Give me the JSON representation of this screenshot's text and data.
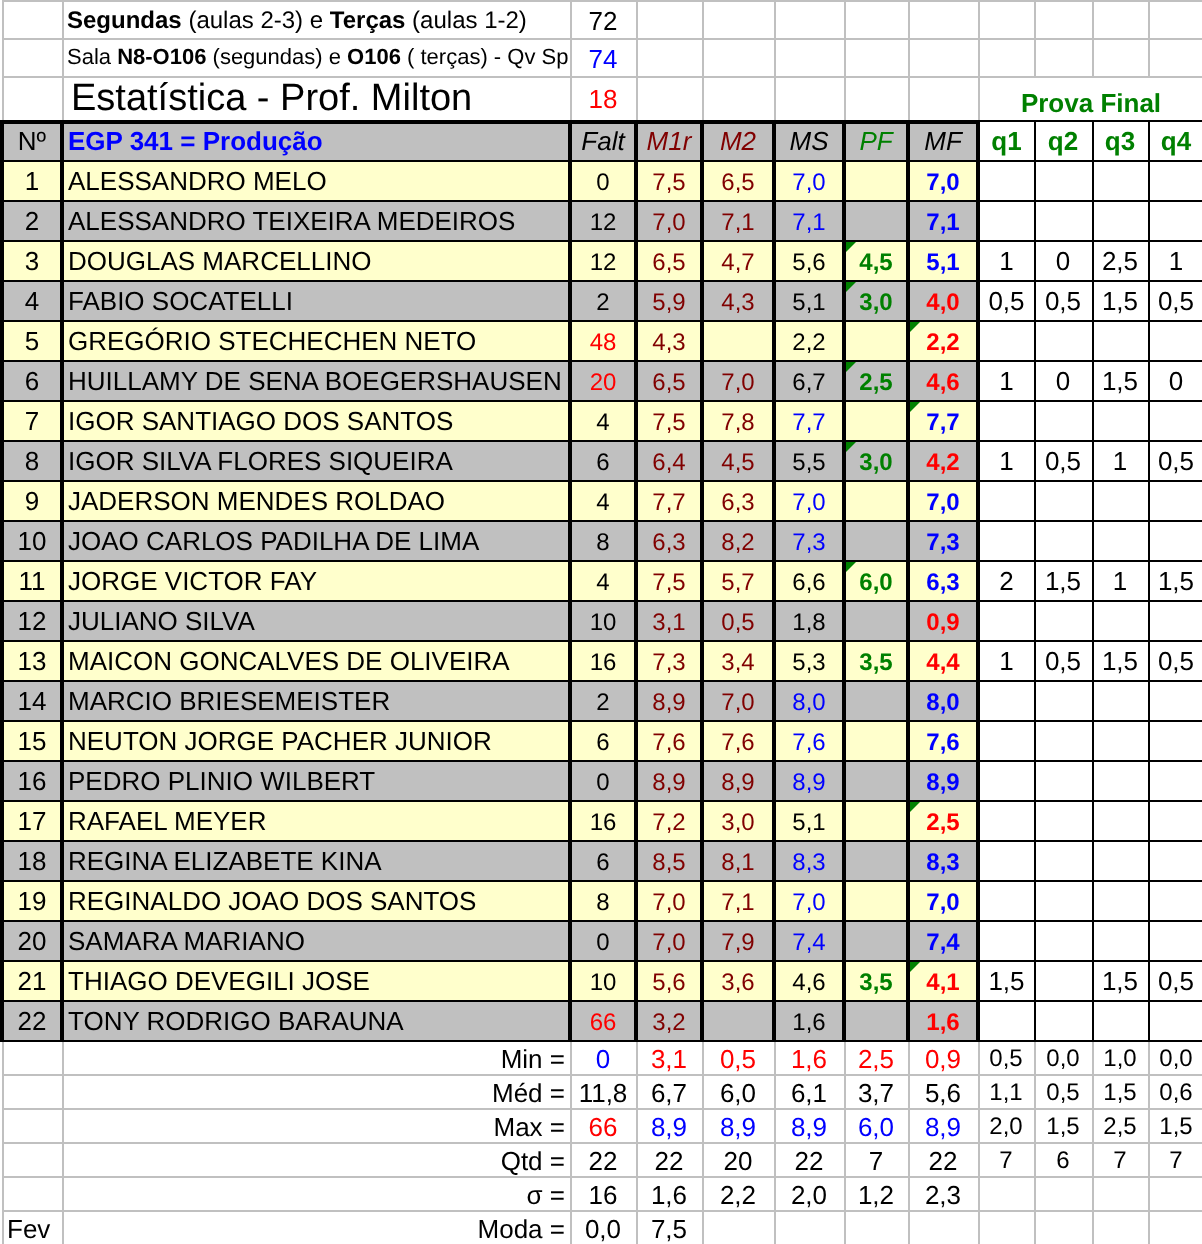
{
  "info": [
    {
      "text": "**Segundas** (aulas 2-3) e **Terças** (aulas 1-2)",
      "value": "72",
      "color": "#000000"
    },
    {
      "text": "Sala **N8-O106** (segundas) e **O106** ( terças) - Qv Sp",
      "value": "74",
      "color": "#0000ff"
    }
  ],
  "title": {
    "text": "Estatística - Prof. Milton",
    "value": "18",
    "color": "#ff0000",
    "group": "Prova Final"
  },
  "columns": [
    "Nº",
    "EGP 341 = Produção",
    "Falt",
    "M1r",
    "M2",
    "MS",
    "PF",
    "MF",
    "q1",
    "q2",
    "q3",
    "q4"
  ],
  "rows": [
    {
      "no": "1",
      "name": "ALESSANDRO MELO",
      "falt": {
        "text": "0",
        "color": "#000000"
      },
      "m1r": "7,5",
      "m2": "6,5",
      "ms": {
        "text": "7,0",
        "color": "#0000ff"
      },
      "mf": {
        "text": "7,0",
        "color": "#0000ff",
        "note": false
      }
    },
    {
      "no": "2",
      "name": "ALESSANDRO TEIXEIRA MEDEIROS",
      "falt": {
        "text": "12",
        "color": "#000000"
      },
      "m1r": "7,0",
      "m2": "7,1",
      "ms": {
        "text": "7,1",
        "color": "#0000ff"
      },
      "mf": {
        "text": "7,1",
        "color": "#0000ff",
        "note": false
      }
    },
    {
      "no": "3",
      "name": "DOUGLAS MARCELLINO",
      "falt": {
        "text": "12",
        "color": "#000000"
      },
      "m1r": "6,5",
      "m2": "4,7",
      "ms": {
        "text": "5,6",
        "color": "#000000"
      },
      "pf": {
        "text": "4,5",
        "note": true
      },
      "mf": {
        "text": "5,1",
        "color": "#0000ff",
        "note": false
      },
      "q": {
        "q1": "1",
        "q2": "0",
        "q3": "2,5",
        "q4": "1"
      }
    },
    {
      "no": "4",
      "name": "FABIO SOCATELLI",
      "falt": {
        "text": "2",
        "color": "#000000"
      },
      "m1r": "5,9",
      "m2": "4,3",
      "ms": {
        "text": "5,1",
        "color": "#000000"
      },
      "pf": {
        "text": "3,0",
        "note": true
      },
      "mf": {
        "text": "4,0",
        "color": "#ff0000",
        "note": false
      },
      "q": {
        "q1": "0,5",
        "q2": "0,5",
        "q3": "1,5",
        "q4": "0,5"
      }
    },
    {
      "no": "5",
      "name": "GREGÓRIO STECHECHEN NETO",
      "falt": {
        "text": "48",
        "color": "#ff0000"
      },
      "m1r": "4,3",
      "ms": {
        "text": "2,2",
        "color": "#000000"
      },
      "mf": {
        "text": "2,2",
        "color": "#ff0000",
        "note": true
      }
    },
    {
      "no": "6",
      "name": "HUILLAMY DE SENA BOEGERSHAUSEN",
      "falt": {
        "text": "20",
        "color": "#ff0000"
      },
      "m1r": "6,5",
      "m2": "7,0",
      "ms": {
        "text": "6,7",
        "color": "#000000"
      },
      "pf": {
        "text": "2,5",
        "note": true
      },
      "mf": {
        "text": "4,6",
        "color": "#ff0000",
        "note": false
      },
      "q": {
        "q1": "1",
        "q2": "0",
        "q3": "1,5",
        "q4": "0"
      }
    },
    {
      "no": "7",
      "name": "IGOR SANTIAGO DOS SANTOS",
      "falt": {
        "text": "4",
        "color": "#000000"
      },
      "m1r": "7,5",
      "m2": "7,8",
      "ms": {
        "text": "7,7",
        "color": "#0000ff"
      },
      "mf": {
        "text": "7,7",
        "color": "#0000ff",
        "note": true
      }
    },
    {
      "no": "8",
      "name": "IGOR SILVA FLORES SIQUEIRA",
      "falt": {
        "text": "6",
        "color": "#000000"
      },
      "m1r": "6,4",
      "m2": "4,5",
      "ms": {
        "text": "5,5",
        "color": "#000000"
      },
      "pf": {
        "text": "3,0",
        "note": true
      },
      "mf": {
        "text": "4,2",
        "color": "#ff0000",
        "note": false
      },
      "q": {
        "q1": "1",
        "q2": "0,5",
        "q3": "1",
        "q4": "0,5"
      }
    },
    {
      "no": "9",
      "name": "JADERSON MENDES ROLDAO",
      "falt": {
        "text": "4",
        "color": "#000000"
      },
      "m1r": "7,7",
      "m2": "6,3",
      "ms": {
        "text": "7,0",
        "color": "#0000ff"
      },
      "mf": {
        "text": "7,0",
        "color": "#0000ff",
        "note": false
      }
    },
    {
      "no": "10",
      "name": "JOAO CARLOS PADILHA DE LIMA",
      "falt": {
        "text": "8",
        "color": "#000000"
      },
      "m1r": "6,3",
      "m2": "8,2",
      "ms": {
        "text": "7,3",
        "color": "#0000ff"
      },
      "mf": {
        "text": "7,3",
        "color": "#0000ff",
        "note": false
      }
    },
    {
      "no": "11",
      "name": "JORGE VICTOR FAY",
      "falt": {
        "text": "4",
        "color": "#000000"
      },
      "m1r": "7,5",
      "m2": "5,7",
      "ms": {
        "text": "6,6",
        "color": "#000000"
      },
      "pf": {
        "text": "6,0",
        "note": true
      },
      "mf": {
        "text": "6,3",
        "color": "#0000ff",
        "note": false
      },
      "q": {
        "q1": "2",
        "q2": "1,5",
        "q3": "1",
        "q4": "1,5"
      }
    },
    {
      "no": "12",
      "name": "JULIANO SILVA",
      "falt": {
        "text": "10",
        "color": "#000000"
      },
      "m1r": "3,1",
      "m2": "0,5",
      "ms": {
        "text": "1,8",
        "color": "#000000"
      },
      "mf": {
        "text": "0,9",
        "color": "#ff0000",
        "note": false
      }
    },
    {
      "no": "13",
      "name": "MAICON GONCALVES DE OLIVEIRA",
      "falt": {
        "text": "16",
        "color": "#000000"
      },
      "m1r": "7,3",
      "m2": "3,4",
      "ms": {
        "text": "5,3",
        "color": "#000000"
      },
      "pf": {
        "text": "3,5",
        "note": false
      },
      "mf": {
        "text": "4,4",
        "color": "#ff0000",
        "note": false
      },
      "q": {
        "q1": "1",
        "q2": "0,5",
        "q3": "1,5",
        "q4": "0,5"
      }
    },
    {
      "no": "14",
      "name": "MARCIO BRIESEMEISTER",
      "falt": {
        "text": "2",
        "color": "#000000"
      },
      "m1r": "8,9",
      "m2": "7,0",
      "ms": {
        "text": "8,0",
        "color": "#0000ff"
      },
      "mf": {
        "text": "8,0",
        "color": "#0000ff",
        "note": false
      }
    },
    {
      "no": "15",
      "name": "NEUTON JORGE PACHER JUNIOR",
      "falt": {
        "text": "6",
        "color": "#000000"
      },
      "m1r": "7,6",
      "m2": "7,6",
      "ms": {
        "text": "7,6",
        "color": "#0000ff"
      },
      "mf": {
        "text": "7,6",
        "color": "#0000ff",
        "note": false
      }
    },
    {
      "no": "16",
      "name": "PEDRO PLINIO WILBERT",
      "falt": {
        "text": "0",
        "color": "#000000"
      },
      "m1r": "8,9",
      "m2": "8,9",
      "ms": {
        "text": "8,9",
        "color": "#0000ff"
      },
      "mf": {
        "text": "8,9",
        "color": "#0000ff",
        "note": false
      }
    },
    {
      "no": "17",
      "name": "RAFAEL MEYER",
      "falt": {
        "text": "16",
        "color": "#000000"
      },
      "m1r": "7,2",
      "m2": "3,0",
      "ms": {
        "text": "5,1",
        "color": "#000000"
      },
      "mf": {
        "text": "2,5",
        "color": "#ff0000",
        "note": true
      }
    },
    {
      "no": "18",
      "name": "REGINA ELIZABETE KINA",
      "falt": {
        "text": "6",
        "color": "#000000"
      },
      "m1r": "8,5",
      "m2": "8,1",
      "ms": {
        "text": "8,3",
        "color": "#0000ff"
      },
      "mf": {
        "text": "8,3",
        "color": "#0000ff",
        "note": false
      }
    },
    {
      "no": "19",
      "name": "REGINALDO JOAO DOS SANTOS",
      "falt": {
        "text": "8",
        "color": "#000000"
      },
      "m1r": "7,0",
      "m2": "7,1",
      "ms": {
        "text": "7,0",
        "color": "#0000ff"
      },
      "mf": {
        "text": "7,0",
        "color": "#0000ff",
        "note": false
      }
    },
    {
      "no": "20",
      "name": "SAMARA MARIANO",
      "falt": {
        "text": "0",
        "color": "#000000"
      },
      "m1r": "7,0",
      "m2": "7,9",
      "ms": {
        "text": "7,4",
        "color": "#0000ff"
      },
      "mf": {
        "text": "7,4",
        "color": "#0000ff",
        "note": false
      }
    },
    {
      "no": "21",
      "name": "THIAGO DEVEGILI JOSE",
      "falt": {
        "text": "10",
        "color": "#000000"
      },
      "m1r": "5,6",
      "m2": "3,6",
      "ms": {
        "text": "4,6",
        "color": "#000000"
      },
      "pf": {
        "text": "3,5",
        "note": false
      },
      "mf": {
        "text": "4,1",
        "color": "#ff0000",
        "note": true
      },
      "q": {
        "q1": "1,5",
        "q3": "1,5",
        "q4": "0,5"
      }
    },
    {
      "no": "22",
      "name": "TONY RODRIGO BARAUNA",
      "falt": {
        "text": "66",
        "color": "#ff0000"
      },
      "m1r": "3,2",
      "ms": {
        "text": "1,6",
        "color": "#000000"
      },
      "mf": {
        "text": "1,6",
        "color": "#ff0000",
        "note": false
      }
    }
  ],
  "summary": [
    {
      "label": "Min =",
      "values": {
        "falt": {
          "text": "0",
          "color": "#0000ff"
        },
        "m1r": {
          "text": "3,1",
          "color": "#ff0000"
        },
        "m2": {
          "text": "0,5",
          "color": "#ff0000"
        },
        "ms": {
          "text": "1,6",
          "color": "#ff0000"
        },
        "pf": {
          "text": "2,5",
          "color": "#ff0000"
        },
        "mf": {
          "text": "0,9",
          "color": "#ff0000"
        },
        "q1": {
          "text": "0,5",
          "color": "#000000"
        },
        "q2": {
          "text": "0,0",
          "color": "#000000"
        },
        "q3": {
          "text": "1,0",
          "color": "#000000"
        },
        "q4": {
          "text": "0,0",
          "color": "#000000"
        }
      }
    },
    {
      "label": "Méd =",
      "values": {
        "falt": {
          "text": "11,8",
          "color": "#000000"
        },
        "m1r": {
          "text": "6,7",
          "color": "#000000"
        },
        "m2": {
          "text": "6,0",
          "color": "#000000"
        },
        "ms": {
          "text": "6,1",
          "color": "#000000"
        },
        "pf": {
          "text": "3,7",
          "color": "#000000"
        },
        "mf": {
          "text": "5,6",
          "color": "#000000"
        },
        "q1": {
          "text": "1,1",
          "color": "#000000"
        },
        "q2": {
          "text": "0,5",
          "color": "#000000"
        },
        "q3": {
          "text": "1,5",
          "color": "#000000"
        },
        "q4": {
          "text": "0,6",
          "color": "#000000"
        }
      }
    },
    {
      "label": "Max =",
      "values": {
        "falt": {
          "text": "66",
          "color": "#ff0000"
        },
        "m1r": {
          "text": "8,9",
          "color": "#0000ff"
        },
        "m2": {
          "text": "8,9",
          "color": "#0000ff"
        },
        "ms": {
          "text": "8,9",
          "color": "#0000ff"
        },
        "pf": {
          "text": "6,0",
          "color": "#0000ff"
        },
        "mf": {
          "text": "8,9",
          "color": "#0000ff"
        },
        "q1": {
          "text": "2,0",
          "color": "#000000"
        },
        "q2": {
          "text": "1,5",
          "color": "#000000"
        },
        "q3": {
          "text": "2,5",
          "color": "#000000"
        },
        "q4": {
          "text": "1,5",
          "color": "#000000"
        }
      }
    },
    {
      "label": "Qtd =",
      "values": {
        "falt": {
          "text": "22",
          "color": "#000000"
        },
        "m1r": {
          "text": "22",
          "color": "#000000"
        },
        "m2": {
          "text": "20",
          "color": "#000000"
        },
        "ms": {
          "text": "22",
          "color": "#000000"
        },
        "pf": {
          "text": "7",
          "color": "#000000"
        },
        "mf": {
          "text": "22",
          "color": "#000000"
        },
        "q1": {
          "text": "7",
          "color": "#000000"
        },
        "q2": {
          "text": "6",
          "color": "#000000"
        },
        "q3": {
          "text": "7",
          "color": "#000000"
        },
        "q4": {
          "text": "7",
          "color": "#000000"
        }
      }
    },
    {
      "label": "σ =",
      "values": {
        "falt": {
          "text": "16",
          "color": "#000000"
        },
        "m1r": {
          "text": "1,6",
          "color": "#000000"
        },
        "m2": {
          "text": "2,2",
          "color": "#000000"
        },
        "ms": {
          "text": "2,0",
          "color": "#000000"
        },
        "pf": {
          "text": "1,2",
          "color": "#000000"
        },
        "mf": {
          "text": "2,3",
          "color": "#000000"
        }
      }
    },
    {
      "label": "Moda =",
      "side": "Fev",
      "values": {
        "falt": {
          "text": "0,0",
          "color": "#000000"
        },
        "m1r": {
          "text": "7,5",
          "color": "#000000"
        }
      }
    }
  ]
}
